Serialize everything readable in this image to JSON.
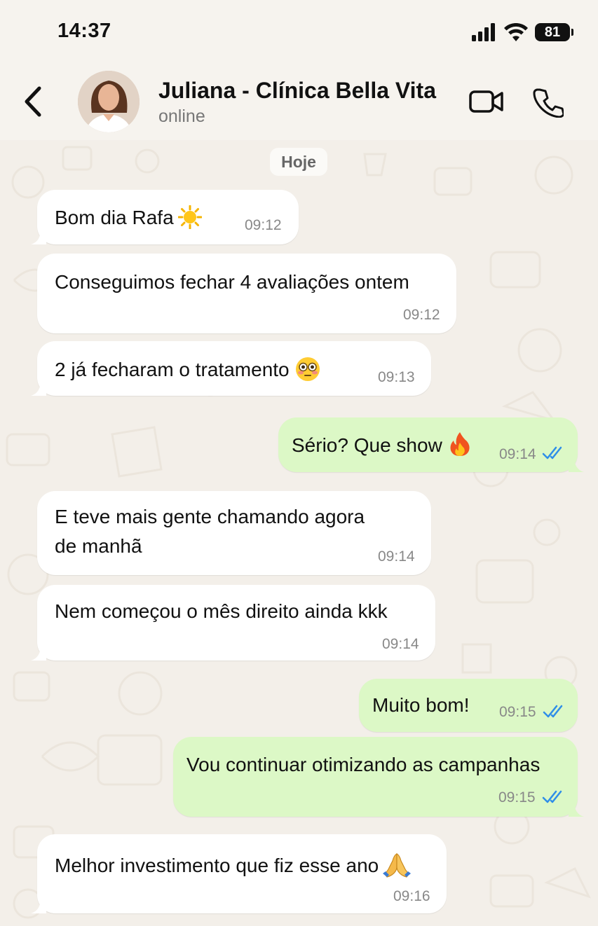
{
  "status_bar": {
    "time": "14:37",
    "battery": "81",
    "icons": [
      "signal-icon",
      "wifi-icon",
      "battery-icon"
    ]
  },
  "header": {
    "contact_name": "Juliana - Clínica Bella Vita",
    "contact_status": "online",
    "icons": [
      "back-arrow-icon",
      "video-call-icon",
      "phone-icon"
    ]
  },
  "day_label": "Hoje",
  "colors": {
    "incoming_bubble": "#ffffff",
    "outgoing_bubble": "#dcf8c6",
    "read_ticks": "#2f8ee8",
    "background": "#f3efe9"
  },
  "messages": [
    {
      "direction": "in",
      "text": "Bom dia Rafa",
      "emoji": "sun",
      "time": "09:12"
    },
    {
      "direction": "in",
      "text": "Conseguimos fechar 4 avaliações ontem",
      "time": "09:12"
    },
    {
      "direction": "in",
      "text": "2 já fecharam o tratamento",
      "emoji": "flushed-face",
      "time": "09:13"
    },
    {
      "direction": "out",
      "text": "Sério? Que show",
      "emoji": "fire",
      "time": "09:14",
      "read": true
    },
    {
      "direction": "in",
      "lines": [
        "E teve mais gente chamando agora",
        "de manhã"
      ],
      "time": "09:14"
    },
    {
      "direction": "in",
      "text": "Nem começou o mês direito ainda kkk",
      "time": "09:14"
    },
    {
      "direction": "out",
      "text": "Muito bom!",
      "time": "09:15",
      "read": true
    },
    {
      "direction": "out",
      "text": "Vou continuar otimizando as campanhas",
      "time": "09:15",
      "read": true
    },
    {
      "direction": "in",
      "text": "Melhor investimento que fiz esse ano",
      "emoji": "folded-hands",
      "time": "09:16"
    }
  ]
}
